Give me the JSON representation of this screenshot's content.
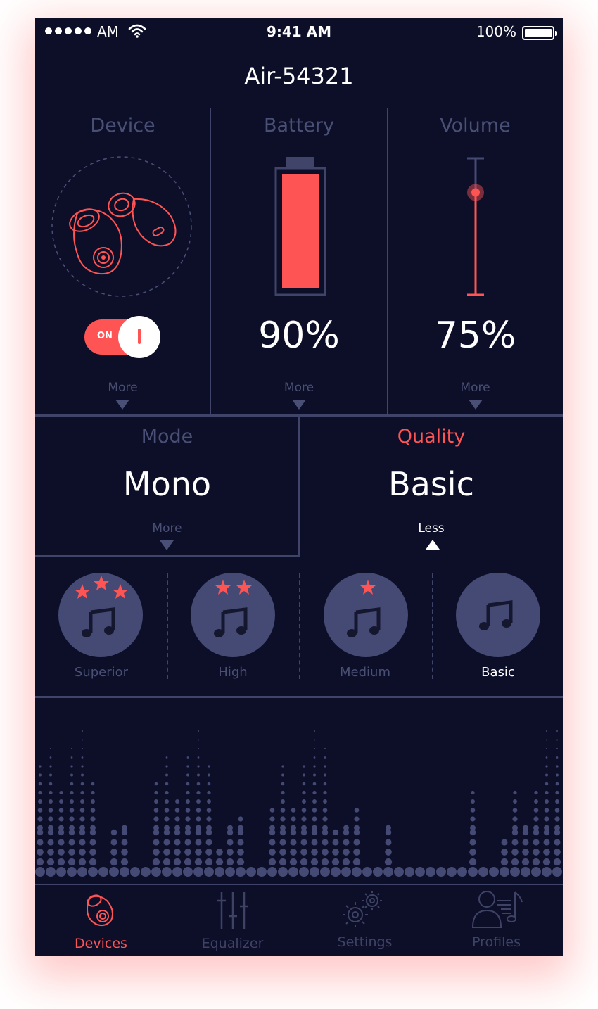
{
  "status_bar": {
    "carrier": "AM",
    "time": "9:41 AM",
    "battery": "100%"
  },
  "header": {
    "device_name": "Air-54321"
  },
  "panels": {
    "device": {
      "title": "Device",
      "toggle": "ON",
      "more": "More"
    },
    "battery": {
      "title": "Battery",
      "value": "90%",
      "level": 0.9,
      "more": "More"
    },
    "volume": {
      "title": "Volume",
      "value": "75%",
      "level": 0.75,
      "more": "More"
    },
    "mode": {
      "title": "Mode",
      "value": "Mono",
      "more": "More"
    },
    "quality": {
      "title": "Quality",
      "value": "Basic",
      "less": "Less"
    }
  },
  "quality_options": [
    {
      "label": "Superior",
      "stars": 3
    },
    {
      "label": "High",
      "stars": 2
    },
    {
      "label": "Medium",
      "stars": 1
    },
    {
      "label": "Basic",
      "stars": 0,
      "selected": true
    }
  ],
  "nav": [
    {
      "label": "Devices",
      "icon": "earbud-icon",
      "active": true
    },
    {
      "label": "Equalizer",
      "icon": "sliders-icon"
    },
    {
      "label": "Settings",
      "icon": "gears-icon"
    },
    {
      "label": "Profiles",
      "icon": "user-music-icon"
    }
  ],
  "colors": {
    "accent": "#ff5454",
    "background": "#0d0f29",
    "muted": "#4a5075",
    "circle": "#454a74"
  }
}
